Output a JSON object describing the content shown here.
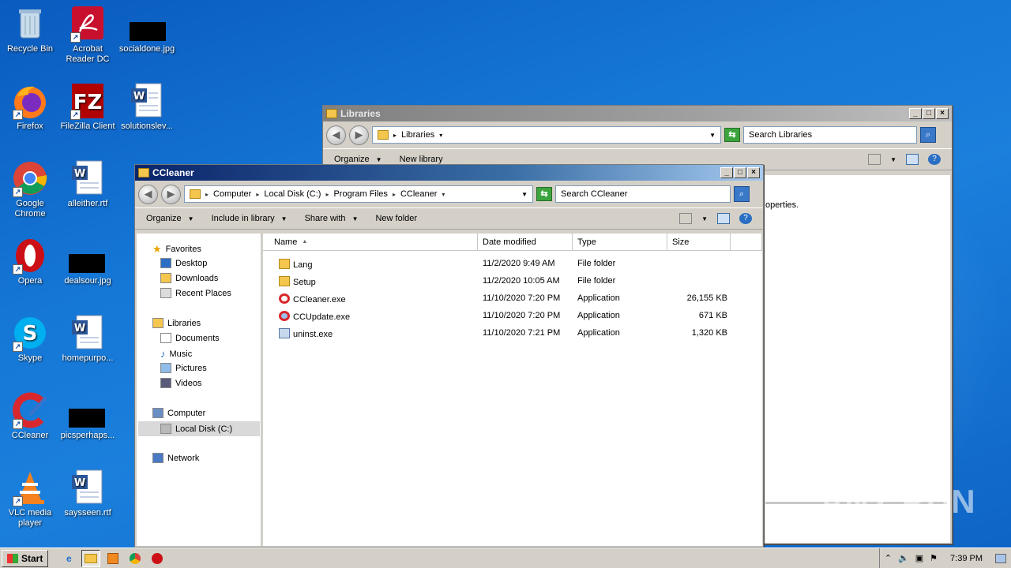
{
  "desktop": {
    "icons": [
      {
        "label": "Recycle Bin"
      },
      {
        "label": "Acrobat Reader DC"
      },
      {
        "label": "socialdone.jpg"
      },
      {
        "label": "Firefox"
      },
      {
        "label": "FileZilla Client"
      },
      {
        "label": "solutionslev..."
      },
      {
        "label": "Google Chrome"
      },
      {
        "label": "alleither.rtf"
      },
      {
        "label": "Opera"
      },
      {
        "label": "dealsour.jpg"
      },
      {
        "label": "Skype"
      },
      {
        "label": "homepurpo..."
      },
      {
        "label": "CCleaner"
      },
      {
        "label": "picsperhaps..."
      },
      {
        "label": "VLC media player"
      },
      {
        "label": "saysseen.rtf"
      }
    ]
  },
  "libraries_window": {
    "title": "Libraries",
    "address": "Libraries",
    "search_placeholder": "Search Libraries",
    "toolbar": {
      "organize": "Organize",
      "new_library": "New library"
    },
    "body_text_fragment": "operties."
  },
  "ccleaner_window": {
    "title": "CCleaner",
    "breadcrumb": [
      "Computer",
      "Local Disk (C:)",
      "Program Files",
      "CCleaner"
    ],
    "search_placeholder": "Search CCleaner",
    "toolbar": {
      "organize": "Organize",
      "include_in_library": "Include in library",
      "share_with": "Share with",
      "new_folder": "New folder"
    },
    "nav": {
      "favorites": "Favorites",
      "desktop": "Desktop",
      "downloads": "Downloads",
      "recent_places": "Recent Places",
      "libraries": "Libraries",
      "documents": "Documents",
      "music": "Music",
      "pictures": "Pictures",
      "videos": "Videos",
      "computer": "Computer",
      "local_disk": "Local Disk (C:)",
      "network": "Network"
    },
    "columns": {
      "name": "Name",
      "date_modified": "Date modified",
      "type": "Type",
      "size": "Size"
    },
    "files": [
      {
        "name": "Lang",
        "date": "11/2/2020 9:49 AM",
        "type": "File folder",
        "size": ""
      },
      {
        "name": "Setup",
        "date": "11/2/2020 10:05 AM",
        "type": "File folder",
        "size": ""
      },
      {
        "name": "CCleaner.exe",
        "date": "11/10/2020 7:20 PM",
        "type": "Application",
        "size": "26,155 KB"
      },
      {
        "name": "CCUpdate.exe",
        "date": "11/10/2020 7:20 PM",
        "type": "Application",
        "size": "671 KB"
      },
      {
        "name": "uninst.exe",
        "date": "11/10/2020 7:21 PM",
        "type": "Application",
        "size": "1,320 KB"
      }
    ]
  },
  "taskbar": {
    "start_label": "Start",
    "clock": "7:39 PM"
  },
  "watermark": "ANY RUN",
  "colors": {
    "accent": "#0a246a",
    "desktop": "#1577d6",
    "folder": "#f4c64e"
  }
}
